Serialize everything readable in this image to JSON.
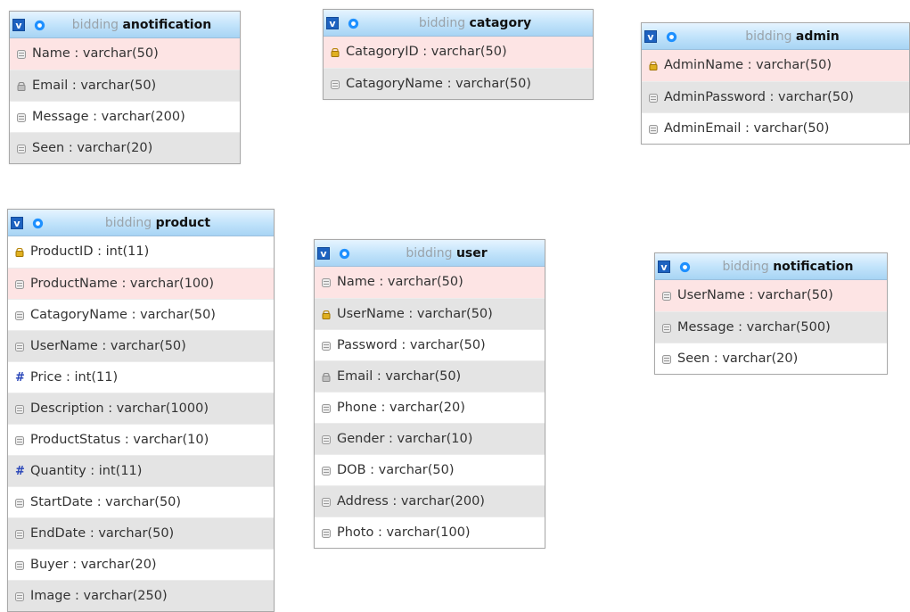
{
  "tables": [
    {
      "db": "bidding",
      "name": "anotification",
      "columns": [
        {
          "text": "Name : varchar(50)",
          "icon": "column-icon"
        },
        {
          "text": "Email : varchar(50)",
          "icon": "index-icon"
        },
        {
          "text": "Message : varchar(200)",
          "icon": "column-icon"
        },
        {
          "text": "Seen : varchar(20)",
          "icon": "column-icon"
        }
      ]
    },
    {
      "db": "bidding",
      "name": "catagory",
      "columns": [
        {
          "text": "CatagoryID : varchar(50)",
          "icon": "key-icon"
        },
        {
          "text": "CatagoryName : varchar(50)",
          "icon": "column-icon"
        }
      ]
    },
    {
      "db": "bidding",
      "name": "admin",
      "columns": [
        {
          "text": "AdminName : varchar(50)",
          "icon": "key-icon"
        },
        {
          "text": "AdminPassword : varchar(50)",
          "icon": "column-icon"
        },
        {
          "text": "AdminEmail : varchar(50)",
          "icon": "column-icon"
        }
      ]
    },
    {
      "db": "bidding",
      "name": "product",
      "columns": [
        {
          "text": "ProductID : int(11)",
          "icon": "key-icon"
        },
        {
          "text": "ProductName : varchar(100)",
          "icon": "column-icon"
        },
        {
          "text": "CatagoryName : varchar(50)",
          "icon": "column-icon"
        },
        {
          "text": "UserName : varchar(50)",
          "icon": "column-icon"
        },
        {
          "text": "Price : int(11)",
          "icon": "numeric-icon"
        },
        {
          "text": "Description : varchar(1000)",
          "icon": "column-icon"
        },
        {
          "text": "ProductStatus : varchar(10)",
          "icon": "column-icon"
        },
        {
          "text": "Quantity : int(11)",
          "icon": "numeric-icon"
        },
        {
          "text": "StartDate : varchar(50)",
          "icon": "column-icon"
        },
        {
          "text": "EndDate : varchar(50)",
          "icon": "column-icon"
        },
        {
          "text": "Buyer : varchar(20)",
          "icon": "column-icon"
        },
        {
          "text": "Image : varchar(250)",
          "icon": "column-icon"
        }
      ]
    },
    {
      "db": "bidding",
      "name": "user",
      "columns": [
        {
          "text": "Name : varchar(50)",
          "icon": "column-icon"
        },
        {
          "text": "UserName : varchar(50)",
          "icon": "key-icon"
        },
        {
          "text": "Password : varchar(50)",
          "icon": "column-icon"
        },
        {
          "text": "Email : varchar(50)",
          "icon": "index-icon"
        },
        {
          "text": "Phone : varchar(20)",
          "icon": "column-icon"
        },
        {
          "text": "Gender : varchar(10)",
          "icon": "column-icon"
        },
        {
          "text": "DOB : varchar(50)",
          "icon": "column-icon"
        },
        {
          "text": "Address : varchar(200)",
          "icon": "column-icon"
        },
        {
          "text": "Photo : varchar(100)",
          "icon": "column-icon"
        }
      ]
    },
    {
      "db": "bidding",
      "name": "notification",
      "columns": [
        {
          "text": "UserName : varchar(50)",
          "icon": "column-icon"
        },
        {
          "text": "Message : varchar(500)",
          "icon": "column-icon"
        },
        {
          "text": "Seen : varchar(20)",
          "icon": "column-icon"
        }
      ]
    }
  ]
}
